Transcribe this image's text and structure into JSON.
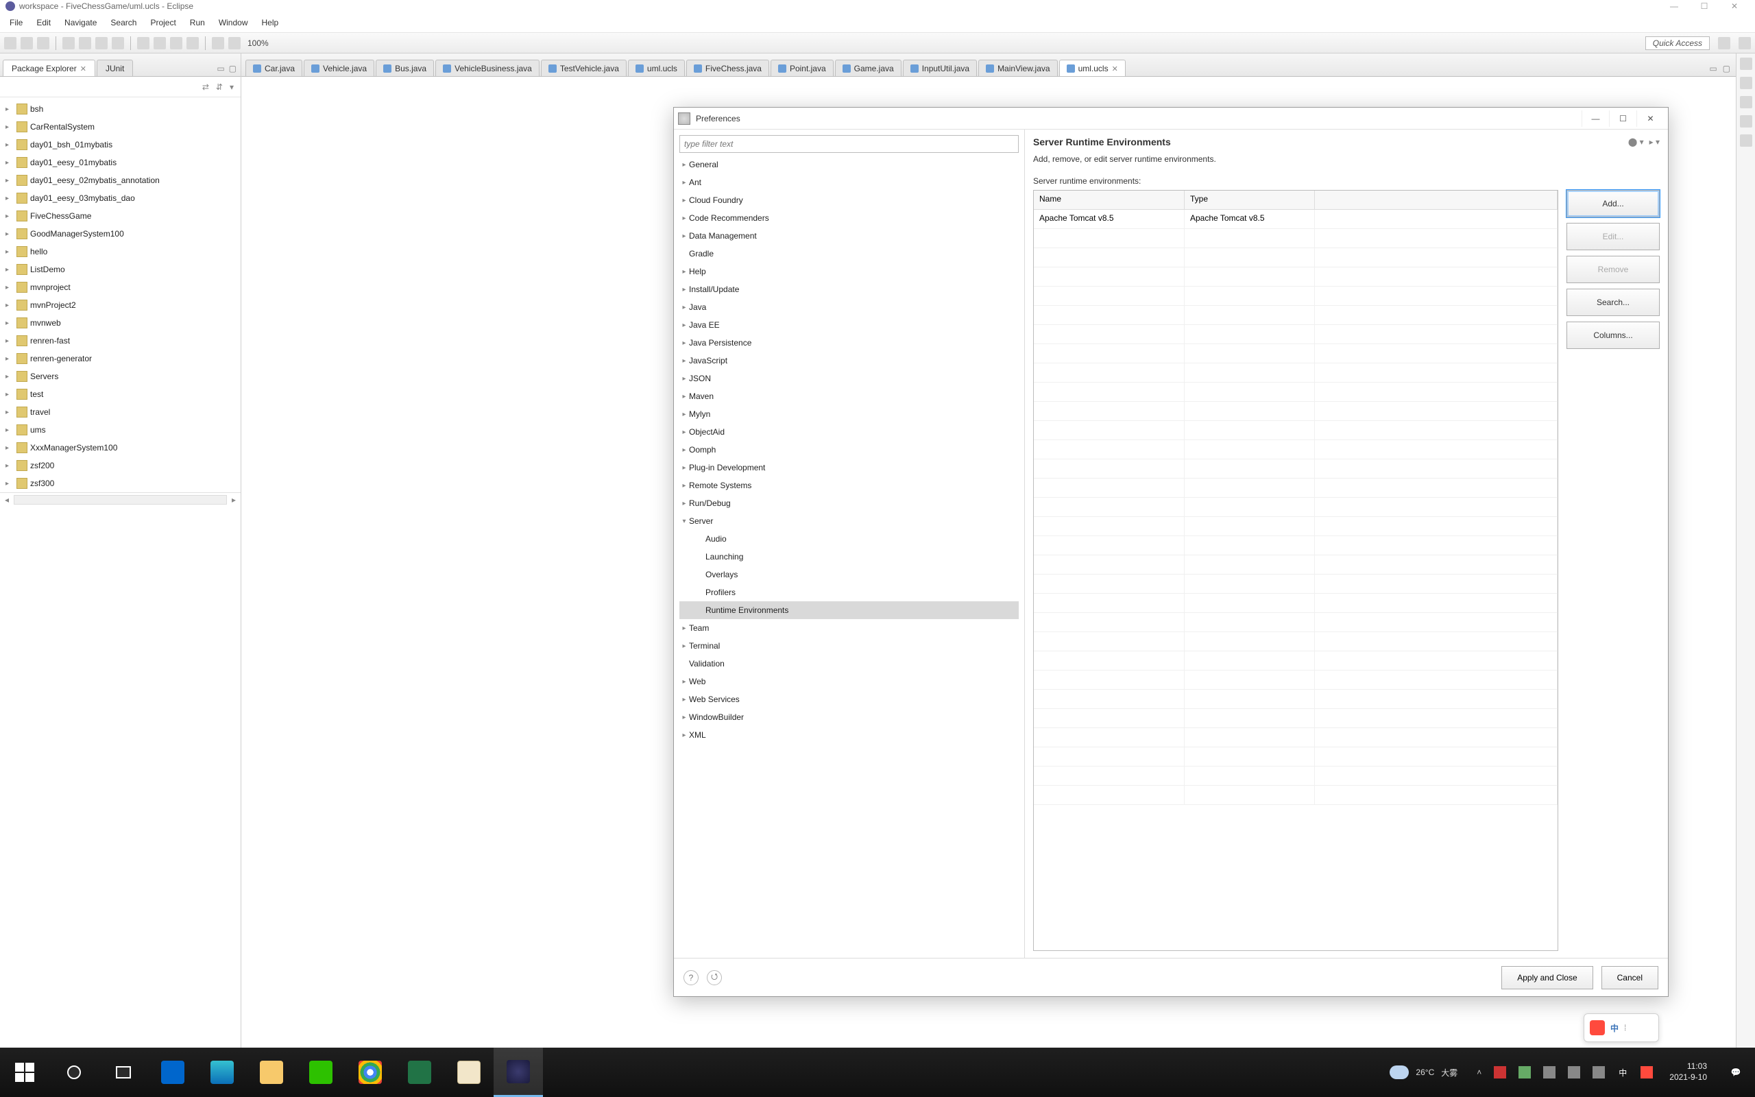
{
  "window": {
    "title": "workspace - FiveChessGame/uml.ucls - Eclipse",
    "min": "—",
    "max": "☐",
    "close": "✕"
  },
  "menubar": [
    "File",
    "Edit",
    "Navigate",
    "Search",
    "Project",
    "Run",
    "Window",
    "Help"
  ],
  "toolbar": {
    "zoom": "100%",
    "quick_access": "Quick Access"
  },
  "pkgview": {
    "tabs": {
      "main": "Package Explorer",
      "second": "JUnit"
    },
    "nodes": [
      "bsh",
      "CarRentalSystem",
      "day01_bsh_01mybatis",
      "day01_eesy_01mybatis",
      "day01_eesy_02mybatis_annotation",
      "day01_eesy_03mybatis_dao",
      "FiveChessGame",
      "GoodManagerSystem100",
      "hello",
      "ListDemo",
      "mvnproject",
      "mvnProject2",
      "mvnweb",
      "renren-fast",
      "renren-generator",
      "Servers",
      "test",
      "travel",
      "ums",
      "XxxManagerSystem100",
      "zsf200",
      "zsf300"
    ]
  },
  "editor": {
    "tabs": [
      "Car.java",
      "Vehicle.java",
      "Bus.java",
      "VehicleBusiness.java",
      "TestVehicle.java",
      "uml.ucls",
      "FiveChess.java",
      "Point.java",
      "Game.java",
      "InputUtil.java",
      "MainView.java",
      "uml.ucls"
    ],
    "active_index": 11
  },
  "dialog": {
    "title": "Preferences",
    "filter_placeholder": "type filter text",
    "tree": [
      {
        "label": "General",
        "exp": false
      },
      {
        "label": "Ant",
        "exp": false
      },
      {
        "label": "Cloud Foundry",
        "exp": false
      },
      {
        "label": "Code Recommenders",
        "exp": false
      },
      {
        "label": "Data Management",
        "exp": false
      },
      {
        "label": "Gradle",
        "leaf": true
      },
      {
        "label": "Help",
        "exp": false
      },
      {
        "label": "Install/Update",
        "exp": false
      },
      {
        "label": "Java",
        "exp": false
      },
      {
        "label": "Java EE",
        "exp": false
      },
      {
        "label": "Java Persistence",
        "exp": false
      },
      {
        "label": "JavaScript",
        "exp": false
      },
      {
        "label": "JSON",
        "exp": false
      },
      {
        "label": "Maven",
        "exp": false
      },
      {
        "label": "Mylyn",
        "exp": false
      },
      {
        "label": "ObjectAid",
        "exp": false
      },
      {
        "label": "Oomph",
        "exp": false
      },
      {
        "label": "Plug-in Development",
        "exp": false
      },
      {
        "label": "Remote Systems",
        "exp": false
      },
      {
        "label": "Run/Debug",
        "exp": false
      },
      {
        "label": "Server",
        "exp": true,
        "children": [
          {
            "label": "Audio"
          },
          {
            "label": "Launching"
          },
          {
            "label": "Overlays"
          },
          {
            "label": "Profilers"
          },
          {
            "label": "Runtime Environments",
            "selected": true
          }
        ]
      },
      {
        "label": "Team",
        "exp": false
      },
      {
        "label": "Terminal",
        "exp": false
      },
      {
        "label": "Validation",
        "leaf": true
      },
      {
        "label": "Web",
        "exp": false
      },
      {
        "label": "Web Services",
        "exp": false
      },
      {
        "label": "WindowBuilder",
        "exp": false
      },
      {
        "label": "XML",
        "exp": false
      }
    ],
    "page": {
      "title": "Server Runtime Environments",
      "desc": "Add, remove, or edit server runtime environments.",
      "table_label": "Server runtime environments:",
      "headers": {
        "name": "Name",
        "type": "Type"
      },
      "rows": [
        {
          "name": "Apache Tomcat v8.5",
          "type": "Apache Tomcat v8.5"
        }
      ],
      "buttons": {
        "add": "Add...",
        "edit": "Edit...",
        "remove": "Remove",
        "search": "Search...",
        "columns": "Columns..."
      }
    },
    "footer": {
      "apply": "Apply and Close",
      "cancel": "Cancel"
    }
  },
  "taskbar": {
    "weather": {
      "temp": "26°C",
      "desc": "大雾"
    },
    "ime": "中",
    "time": "11:03",
    "date": "2021-9-10"
  },
  "sogou": {
    "txt": "中",
    "menu": "⁞"
  }
}
